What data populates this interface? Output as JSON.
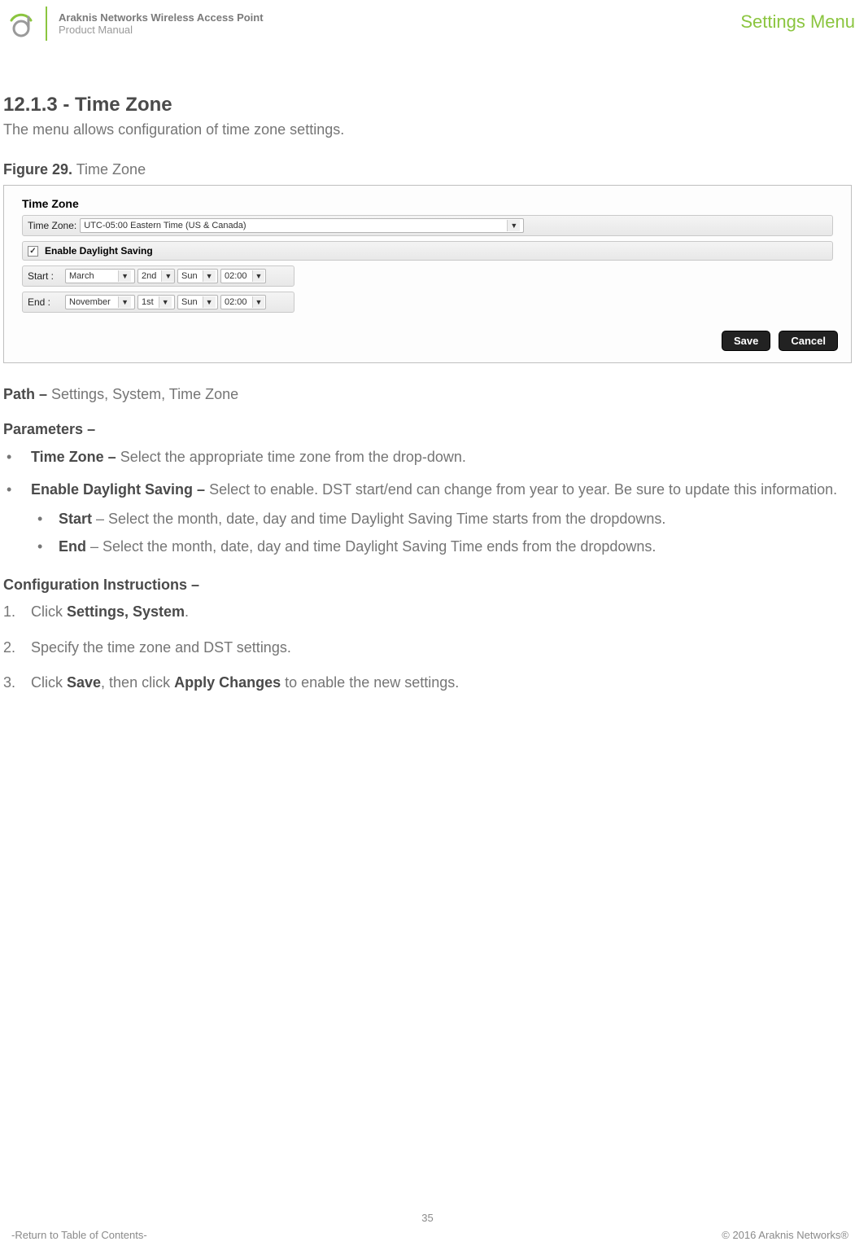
{
  "header": {
    "product_line1": "Araknis Networks Wireless Access Point",
    "product_line2": "Product Manual",
    "menu_label": "Settings Menu"
  },
  "section": {
    "number_title": "12.1.3 - Time Zone",
    "intro": "The menu allows configuration of time zone settings."
  },
  "figure": {
    "label": "Figure 29.",
    "caption": "Time Zone"
  },
  "panel": {
    "heading": "Time Zone",
    "tz_label": "Time Zone:",
    "tz_value": "UTC-05:00 Eastern Time (US & Canada)",
    "dst_label": "Enable Daylight Saving",
    "dst_checked": "✓",
    "start_label": "Start :",
    "start_month_label": "March",
    "start_week_label": "2nd",
    "start_day_label": "Sun",
    "start_time_label": "02:00",
    "end_label": "End  :",
    "end_month_label": "November",
    "end_week_label": "1st",
    "end_day_label": "Sun",
    "end_time_label": "02:00",
    "save_btn": "Save",
    "cancel_btn": "Cancel"
  },
  "path": {
    "label": "Path – ",
    "value": "Settings, System, Time Zone"
  },
  "parameters": {
    "heading": "Parameters –",
    "items": [
      {
        "term": "Time Zone – ",
        "desc": "Select the appropriate time zone from the drop-down."
      },
      {
        "term": "Enable Daylight Saving – ",
        "desc": "Select to enable. DST start/end can change from year to year. Be sure to update this information.",
        "sub": [
          {
            "term": "Start",
            "desc": " – Select the month, date, day and time Daylight Saving Time starts from the dropdowns."
          },
          {
            "term": "End",
            "desc": " – Select the month, date, day and time Daylight Saving Time ends from the dropdowns."
          }
        ]
      }
    ]
  },
  "config": {
    "heading": "Configuration Instructions –",
    "step1_pre": "Click ",
    "step1_bold": "Settings, System",
    "step1_post": ".",
    "step2": "Specify the time zone and DST settings.",
    "step3_pre": "Click ",
    "step3_b1": "Save",
    "step3_mid": ", then click ",
    "step3_b2": "Apply Changes",
    "step3_post": " to enable the new settings."
  },
  "footer": {
    "page": "35",
    "toc": "-Return to Table of Contents-",
    "copyright": "© 2016 Araknis Networks®"
  }
}
